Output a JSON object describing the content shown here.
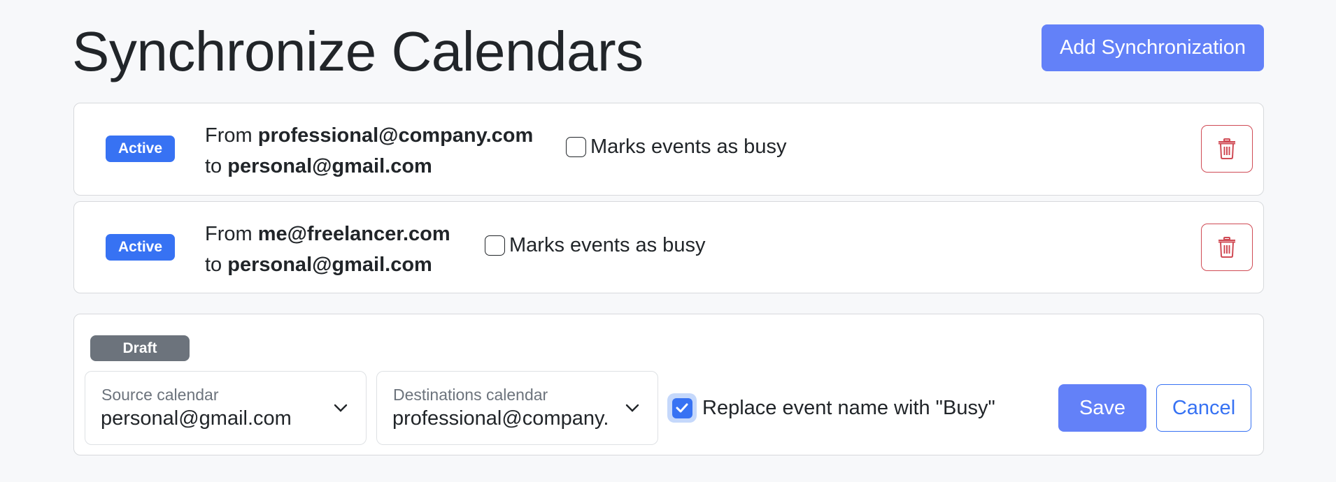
{
  "header": {
    "title": "Synchronize Calendars",
    "add_button_label": "Add Synchronization"
  },
  "colors": {
    "primary": "#6381f8",
    "badge_active": "#3772f3",
    "badge_draft": "#6c737c",
    "danger": "#d04b55"
  },
  "synchronizations": [
    {
      "status": "Active",
      "from_prefix": "From",
      "from": "professional@company.com",
      "to_prefix": "to",
      "to": "personal@gmail.com",
      "busy_label": "Marks events as busy",
      "busy_checked": false,
      "delete_icon": "trash-icon"
    },
    {
      "status": "Active",
      "from_prefix": "From",
      "from": "me@freelancer.com",
      "to_prefix": "to",
      "to": "personal@gmail.com",
      "busy_label": "Marks events as busy",
      "busy_checked": false,
      "delete_icon": "trash-icon"
    }
  ],
  "draft": {
    "status": "Draft",
    "source": {
      "label": "Source calendar",
      "value": "personal@gmail.com"
    },
    "destination": {
      "label": "Destinations calendar",
      "value": "professional@company."
    },
    "replace_label": "Replace event name with \"Busy\"",
    "replace_checked": true,
    "save_label": "Save",
    "cancel_label": "Cancel"
  }
}
